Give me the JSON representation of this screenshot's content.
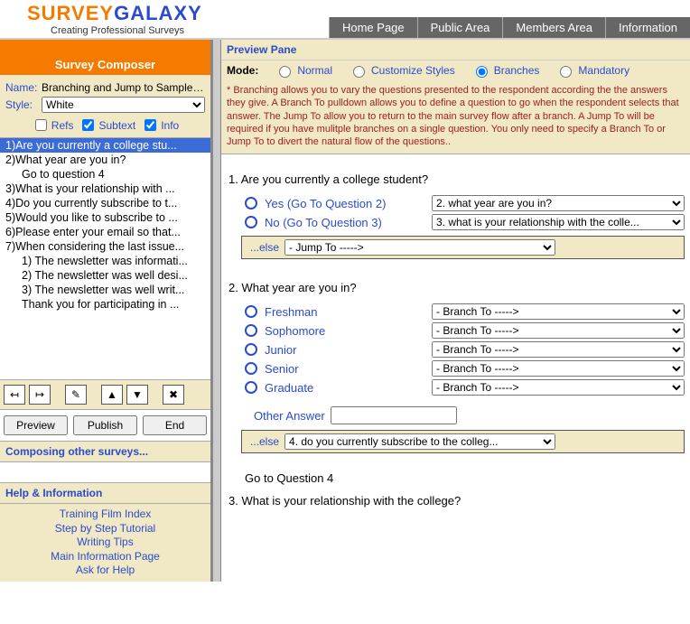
{
  "brand": {
    "word1": "SURVEY",
    "word2": "GALAXY",
    "tagline": "Creating Professional Surveys"
  },
  "nav": {
    "home": "Home Page",
    "public": "Public Area",
    "members": "Members Area",
    "info": "Information"
  },
  "composer": {
    "title": "Survey Composer",
    "name_label": "Name:",
    "name_value": "Branching and Jump to Sample Su...",
    "style_label": "Style:",
    "style_value": "White",
    "refs_label": "Refs",
    "subtext_label": "Subtext",
    "info_label": "Info"
  },
  "questions": [
    {
      "t": "1)Are you currently a college stu...",
      "sel": true
    },
    {
      "t": "2)What year are you in?"
    },
    {
      "t": "Go to question 4",
      "sub": true
    },
    {
      "t": "3)What is your relationship with ..."
    },
    {
      "t": "4)Do you currently subscribe to t..."
    },
    {
      "t": "5)Would you like to subscribe to ..."
    },
    {
      "t": "6)Please enter your email so that..."
    },
    {
      "t": "7)When considering the last issue..."
    },
    {
      "t": "1) The newsletter was informati...",
      "sub": true
    },
    {
      "t": "2) The newsletter was well desi...",
      "sub": true
    },
    {
      "t": "3) The newsletter was well writ...",
      "sub": true
    },
    {
      "t": "Thank you for participating in ...",
      "sub": true
    }
  ],
  "buttons": {
    "preview": "Preview",
    "publish": "Publish",
    "end": "End"
  },
  "panels": {
    "other_surveys": "Composing other surveys...",
    "help": "Help & Information"
  },
  "help_links": {
    "l1": "Training Film Index",
    "l2": "Step by Step Tutorial",
    "l3": "Writing Tips",
    "l4": "Main Information Page",
    "l5": "Ask for Help"
  },
  "preview": {
    "title": "Preview Pane",
    "mode_label": "Mode:",
    "mode_normal": "Normal",
    "mode_customize": "Customize Styles",
    "mode_branches": "Branches",
    "mode_mandatory": "Mandatory",
    "note": "* Branching allows you to vary the questions presented to the respondent according the the answers they give. A Branch To pulldown allows you to define a question to go when the respondent selects that answer. The Jump To allow you to return to the main survey flow after a branch. A Jump To will be required if you have mulitple branches on a single question. You only need to specify a Branch To or Jump To to divert the natural flow of the questions.."
  },
  "q1": {
    "text": "1. Are you currently a college student?",
    "opt1_label": "Yes (Go To Question 2)",
    "opt1_select": "2. what year are you in?",
    "opt2_label": "No (Go To Question 3)",
    "opt2_select": "3. what is your relationship with the colle...",
    "else_label": "...else",
    "else_select": "- Jump To ----->"
  },
  "q2": {
    "text": "2. What year are you in?",
    "o1": "Freshman",
    "o2": "Sophomore",
    "o3": "Junior",
    "o4": "Senior",
    "o5": "Graduate",
    "branch": "- Branch To ----->",
    "other_label": "Other Answer",
    "else_label": "...else",
    "else_select": "4. do you currently subscribe to the colleg..."
  },
  "goto4": "Go to Question 4",
  "q3": {
    "text": "3. What is your relationship with the college?"
  }
}
